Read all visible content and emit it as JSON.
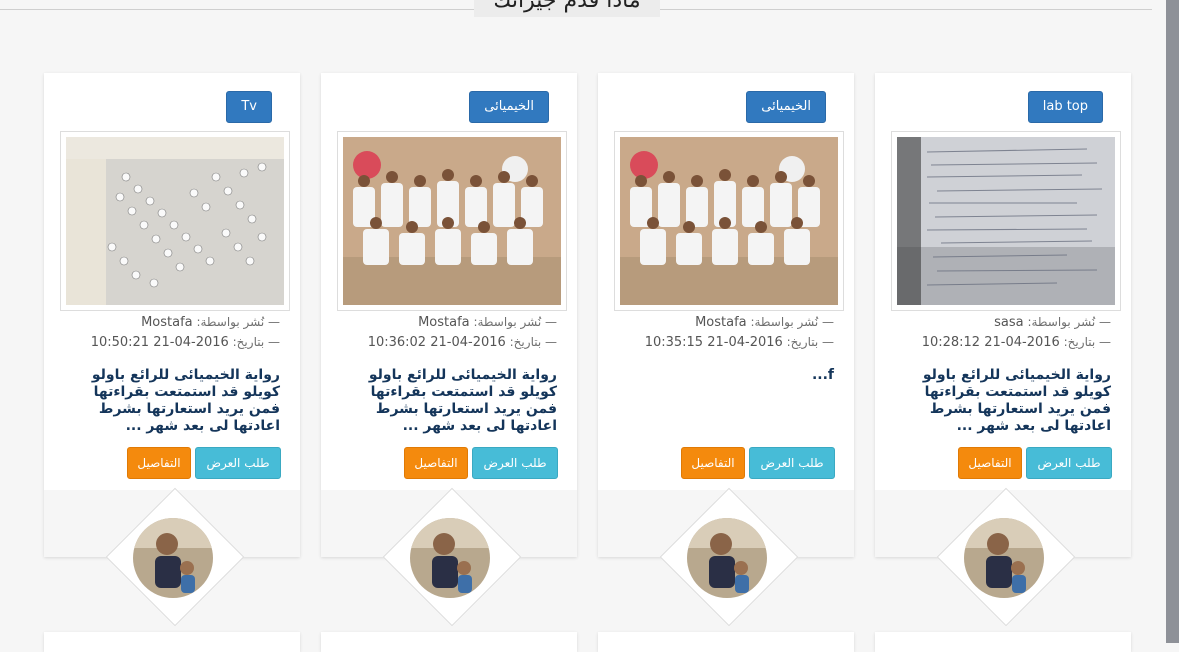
{
  "section": {
    "title": "ماذا قدم جيرانك"
  },
  "labels": {
    "posted_by": "— نُشر بواسطة:",
    "date": "— بتاريخ:",
    "request_button": "طلب العرض",
    "details_button": "التفاصيل"
  },
  "cards": [
    {
      "category": "lab top",
      "author": "sasa",
      "date": "2016-04-21 10:28:12",
      "description": "رواية الخيميائى للرائع باولو كويلو قد استمتعت بقراءتها فمن يريد استعارتها بشرط اعادتها لى بعد شهر ..."
    },
    {
      "category": "الخيميائى",
      "author": "Mostafa",
      "date": "2016-04-21 10:35:15",
      "description": "f..."
    },
    {
      "category": "الخيميائى",
      "author": "Mostafa",
      "date": "2016-04-21 10:36:02",
      "description": "رواية الخيميائى للرائع باولو كويلو قد استمتعت بقراءتها فمن يريد استعارتها بشرط اعادتها لى بعد شهر ..."
    },
    {
      "category": "Tv",
      "author": "Mostafa",
      "date": "2016-04-21 10:50:21",
      "description": "رواية الخيميائى للرائع باولو كويلو قد استمتعت بقراءتها فمن يريد استعارتها بشرط اعادتها لى بعد شهر ..."
    }
  ],
  "colors": {
    "category_button": "#3179bf",
    "request_button": "#47bcd7",
    "details_button": "#f48a0d",
    "description_text": "#14355a"
  }
}
